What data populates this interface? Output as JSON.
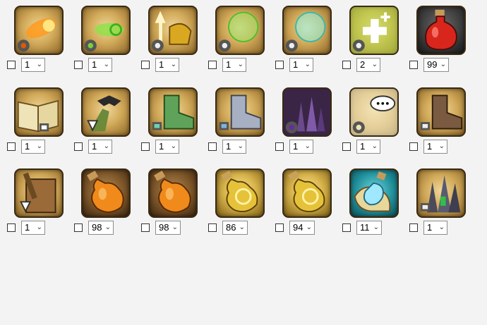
{
  "items": [
    {
      "icon": "fireball-icon",
      "qty": "1",
      "checked": false
    },
    {
      "icon": "green-swirl-icon",
      "qty": "1",
      "checked": false
    },
    {
      "icon": "golden-arrow-boots-icon",
      "qty": "1",
      "checked": false
    },
    {
      "icon": "green-shield-orb-icon",
      "qty": "1",
      "checked": false
    },
    {
      "icon": "cyan-shield-orb-icon",
      "qty": "1",
      "checked": false
    },
    {
      "icon": "green-plus-heal-icon",
      "qty": "2",
      "checked": false
    },
    {
      "icon": "red-potion-icon",
      "qty": "99",
      "checked": false
    },
    {
      "icon": "open-book-icon",
      "qty": "1",
      "checked": false
    },
    {
      "icon": "bat-tree-icon",
      "qty": "1",
      "checked": false
    },
    {
      "icon": "green-boot-icon",
      "qty": "1",
      "checked": false
    },
    {
      "icon": "silver-boot-icon",
      "qty": "1",
      "checked": false
    },
    {
      "icon": "purple-crystal-cave-icon",
      "qty": "1",
      "checked": false
    },
    {
      "icon": "speech-bubble-icon",
      "qty": "1",
      "checked": false
    },
    {
      "icon": "brown-boot-icon",
      "qty": "1",
      "checked": false
    },
    {
      "icon": "tome-with-scope-icon",
      "qty": "1",
      "checked": false
    },
    {
      "icon": "orange-potion-icon",
      "qty": "98",
      "checked": false
    },
    {
      "icon": "orange-potion-icon",
      "qty": "98",
      "checked": false
    },
    {
      "icon": "gold-ring-potion-icon",
      "qty": "86",
      "checked": false
    },
    {
      "icon": "gold-ring-potion-icon",
      "qty": "94",
      "checked": false
    },
    {
      "icon": "blue-potion-scroll-icon",
      "qty": "11",
      "checked": false
    },
    {
      "icon": "dark-crystal-icon",
      "qty": "1",
      "checked": false
    }
  ],
  "colors": {
    "background": "#f3f3f3",
    "frame": "#3a2a12"
  }
}
